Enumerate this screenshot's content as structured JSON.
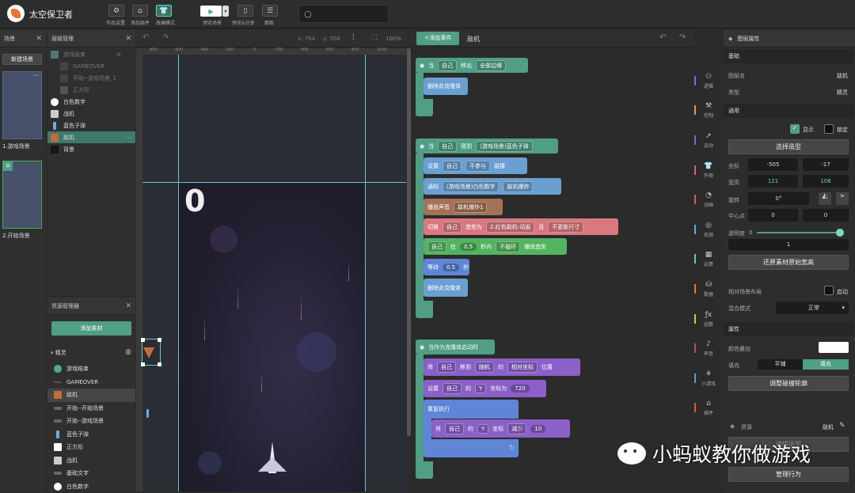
{
  "app": {
    "title": "太空保卫者"
  },
  "toolbar": {
    "buttons": [
      {
        "icon": "gear-icon",
        "label": "作品设置"
      },
      {
        "icon": "home-plugin-icon",
        "label": "添加插件"
      },
      {
        "icon": "shirt-icon",
        "label": "改编模式"
      }
    ],
    "preview_label": "预览场景",
    "share_label": "预览&分享",
    "panel_label": "面板"
  },
  "scenes": {
    "title": "场景",
    "new_label": "新建场景",
    "items": [
      "1.游戏场景",
      "2.开始场景"
    ]
  },
  "layers": {
    "title": "层级管理",
    "items": [
      {
        "name": "游戏结束",
        "dim": true
      },
      {
        "name": "GAMEOVER",
        "dim": true
      },
      {
        "name": "开始--游戏场景_1",
        "dim": true
      },
      {
        "name": "正方形",
        "dim": true
      },
      {
        "name": "白色数字",
        "dim": false
      },
      {
        "name": "战机",
        "dim": false
      },
      {
        "name": "蓝色子弹",
        "dim": false
      },
      {
        "name": "敌机",
        "dim": false,
        "selected": true
      },
      {
        "name": "背景",
        "dim": false
      }
    ]
  },
  "assets": {
    "title": "资源管理器",
    "add_label": "添加素材",
    "group": "精灵",
    "items": [
      "游戏结束",
      "GAMEOVER",
      "敌机",
      "开始--开始场景",
      "开始--游戏场景",
      "蓝色子弹",
      "正方形",
      "战机",
      "基础文字",
      "白色数字"
    ]
  },
  "stage": {
    "coord_x": "x: 794",
    "coord_y": "y: 568",
    "zoom": "100%",
    "score": "0",
    "ruler_labels": [
      "-800",
      "-600",
      "-400",
      "-200",
      "0",
      "200",
      "400",
      "600",
      "800",
      "1000"
    ]
  },
  "code": {
    "add_event": "添加事件",
    "target": "敌机"
  },
  "blocks": {
    "e1": {
      "when": "当",
      "self": "自己",
      "move_out": "移出",
      "edge": "全部边缘",
      "del": "删除此克隆体"
    },
    "e2": {
      "when": "当",
      "self": "自己",
      "touch": "碰到",
      "target": "(游戏场景)蓝色子弹",
      "set": "设置",
      "self2": "自己",
      "mode": "不参与",
      "collide": "碰撞",
      "notify": "通知",
      "nt": "(游戏场景)白色数字",
      "msg": "敌机爆炸",
      "play": "播放声音",
      "sound": "敌机爆炸1",
      "switch": "切换",
      "self3": "自己",
      "shape_lbl": "造型为",
      "shape": "2.红色敌机-动画",
      "and": "且",
      "size": "不更新尺寸",
      "self4": "自己",
      "in": "在",
      "secs": "0.5",
      "within": "秒内",
      "loop": "不循环",
      "playshape": "播放造型",
      "wait": "等待",
      "wsecs": "0.5",
      "sec": "秒",
      "del": "删除此克隆体"
    },
    "e3": {
      "start": "当作为克隆体启动时",
      "move": "将",
      "self": "自己",
      "moveto": "移到",
      "random": "随机",
      "of": "的",
      "rel": "相对坐标",
      "pos": "位置",
      "set": "设置",
      "self2": "自己",
      "of2": "的",
      "axis": "Y",
      "coordto": "坐标为",
      "yval": "720",
      "repeat": "重复执行",
      "will": "将",
      "self3": "自己",
      "of3": "的",
      "axis2": "Y",
      "coord": "坐标",
      "dec": "减少",
      "dval": "10"
    }
  },
  "categories": [
    {
      "label": "逻辑",
      "color": "#5b7fd6"
    },
    {
      "label": "控制",
      "color": "#d6a23a"
    },
    {
      "label": "运动",
      "color": "#8e5bd6"
    },
    {
      "label": "外观",
      "color": "#d65b8e"
    },
    {
      "label": "动画",
      "color": "#d65b5b"
    },
    {
      "label": "侦测",
      "color": "#5bb0d6"
    },
    {
      "label": "运算",
      "color": "#5bd68a"
    },
    {
      "label": "数据",
      "color": "#d67f3a"
    },
    {
      "label": "函数",
      "color": "#d6c43a"
    },
    {
      "label": "声音",
      "color": "#a04f7f"
    },
    {
      "label": "小游戏",
      "color": "#5b9ed6"
    },
    {
      "label": "插件",
      "color": "#d65b3a"
    }
  ],
  "props": {
    "title": "图层属性",
    "basic": "基础",
    "name_lbl": "图层名",
    "name_val": "敌机",
    "type_lbl": "类型",
    "type_val": "精灵",
    "general": "通用",
    "show": "显示",
    "lock": "锁定",
    "pick_shape": "选择造型",
    "coord_lbl": "坐标",
    "cx": "-505",
    "cy": "-17",
    "wh_lbl": "宽高",
    "w": "121",
    "h": "106",
    "rot_lbl": "旋转",
    "rot": "0°",
    "center_lbl": "中心点",
    "c1": "0",
    "c2": "0",
    "alpha_lbl": "透明度",
    "alpha_min": "0",
    "alpha_val": "1",
    "restore": "还原素材原始宽高",
    "relative_lbl": "相对场景布局",
    "enable": "启动",
    "blend_lbl": "混合模式",
    "blend": "正常",
    "attr": "属性",
    "color_lbl": "颜色叠加",
    "fill_lbl": "填充",
    "tile": "平铺",
    "fill": "填充",
    "adjust": "调整碰撞轮廓",
    "asset_lbl": "资源",
    "asset_val": "敌机",
    "manage": "管理行为",
    "partial": "编辑造型"
  },
  "watermark": "小蚂蚁教你做游戏"
}
